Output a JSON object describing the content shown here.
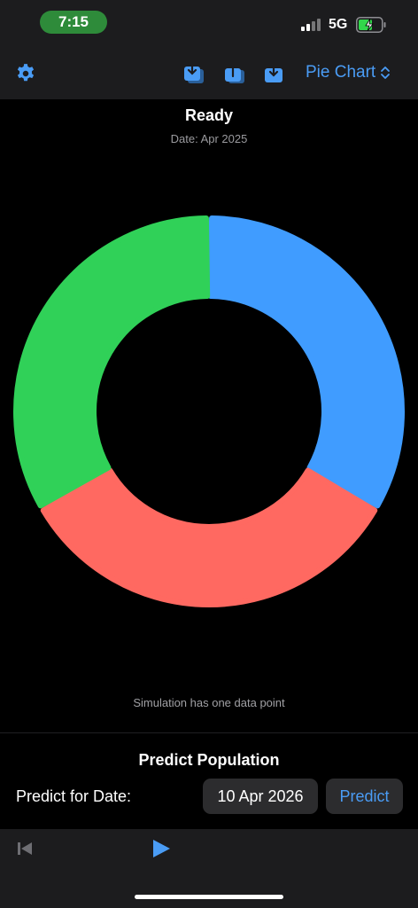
{
  "status_bar": {
    "time": "7:15",
    "network": "5G",
    "battery_level": 0.6
  },
  "toolbar": {
    "icons": [
      "gear-icon",
      "import-icon",
      "share-icon",
      "download-icon"
    ],
    "chart_type": "Pie Chart"
  },
  "main": {
    "status_title": "Ready",
    "status_date": "Date: Apr 2025",
    "note": "Simulation has one data point"
  },
  "chart_data": {
    "type": "pie",
    "donut": true,
    "values": [
      1,
      1,
      1
    ],
    "colors": [
      "#409cff",
      "#ff6961",
      "#30d158"
    ]
  },
  "predict": {
    "title": "Predict Population",
    "label": "Predict for Date:",
    "date_value": "10 Apr 2026",
    "button_label": "Predict"
  },
  "bottom_bar": {
    "icons": [
      "skip-back-icon",
      "play-icon"
    ]
  },
  "colors": {
    "accent": "#4a9cf5",
    "bar_background": "#1c1c1e",
    "button_background": "#2c2c2e"
  }
}
